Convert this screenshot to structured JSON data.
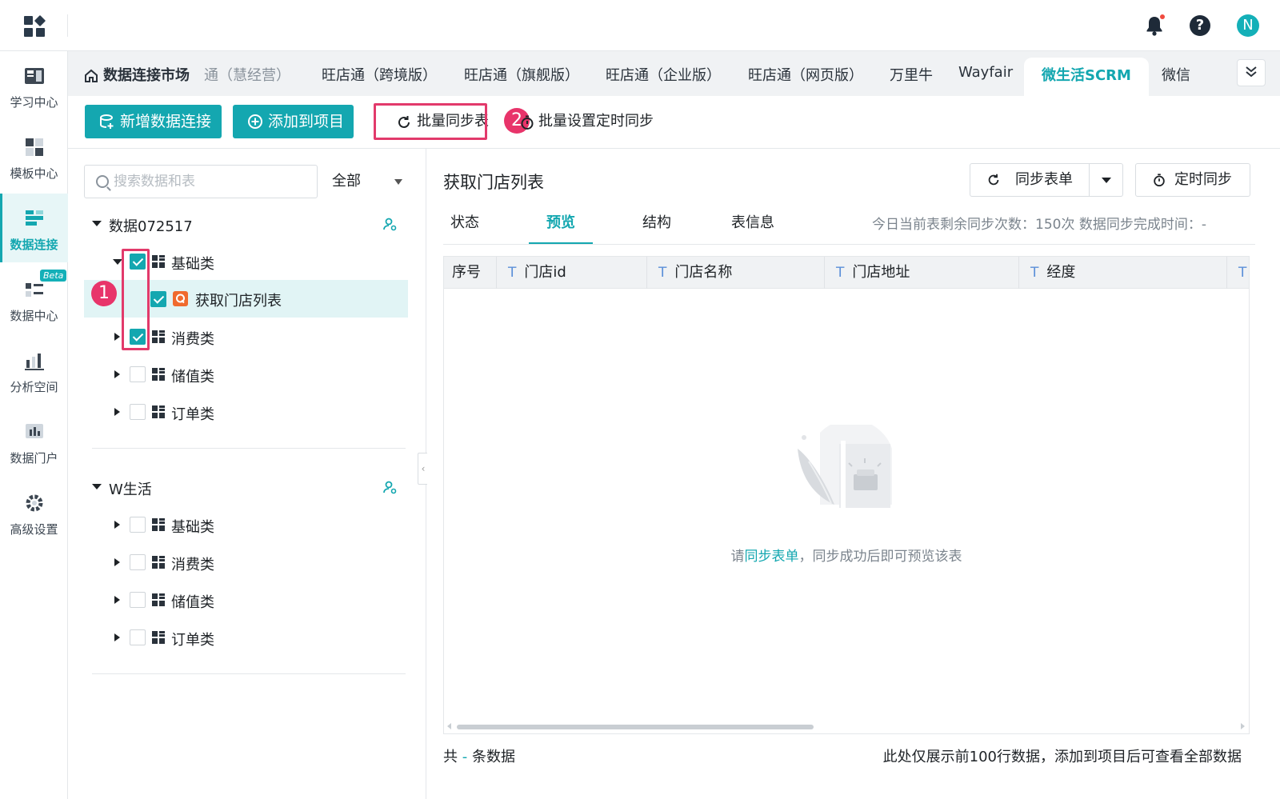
{
  "header": {
    "notification_dot": true,
    "help": "?",
    "avatar": "N"
  },
  "leftnav": {
    "items": [
      {
        "label": "学习中心",
        "icon": "book-icon"
      },
      {
        "label": "模板中心",
        "icon": "template-icon"
      },
      {
        "label": "数据连接",
        "icon": "data-connect-icon",
        "active": true
      },
      {
        "label": "数据中心",
        "icon": "data-center-icon",
        "badge": "Beta"
      },
      {
        "label": "分析空间",
        "icon": "analysis-icon"
      },
      {
        "label": "数据门户",
        "icon": "portal-icon"
      },
      {
        "label": "高级设置",
        "icon": "gear-icon"
      }
    ]
  },
  "tabs": {
    "home": "数据连接市场",
    "items": [
      "通（慧经营）",
      "旺店通（跨境版）",
      "旺店通（旗舰版）",
      "旺店通（企业版）",
      "旺店通（网页版）",
      "万里牛",
      "Wayfair",
      "微生活SCRM",
      "微信"
    ],
    "active": "微生活SCRM"
  },
  "toolbar": {
    "new_connection": "新增数据连接",
    "add_to_project": "添加到项目",
    "batch_sync": "批量同步表",
    "batch_timed_sync": "批量设置定时同步",
    "badge1": "1",
    "badge2": "2"
  },
  "tree": {
    "search_placeholder": "搜索数据和表",
    "scope": "全部",
    "groups": [
      {
        "name": "数据072517",
        "children": [
          {
            "label": "基础类",
            "checked": true,
            "expanded": true
          },
          {
            "label": "获取门店列表",
            "checked": true,
            "leaf": true,
            "selected": true
          },
          {
            "label": "消费类",
            "checked": true
          },
          {
            "label": "储值类",
            "checked": false
          },
          {
            "label": "订单类",
            "checked": false
          }
        ]
      },
      {
        "name": "W生活",
        "children": [
          {
            "label": "基础类",
            "checked": false
          },
          {
            "label": "消费类",
            "checked": false
          },
          {
            "label": "储值类",
            "checked": false
          },
          {
            "label": "订单类",
            "checked": false
          }
        ]
      }
    ]
  },
  "detail": {
    "title": "获取门店列表",
    "sync_button": "同步表单",
    "timed_sync_button": "定时同步",
    "tabs": [
      "状态",
      "预览",
      "结构",
      "表信息"
    ],
    "active_tab": "预览",
    "sync_info": "今日当前表剩余同步次数：150次   数据同步完成时间：-",
    "columns": [
      "序号",
      "门店id",
      "门店名称",
      "门店地址",
      "经度",
      ""
    ],
    "column_type": "T",
    "empty_prefix": "请",
    "empty_link": "同步表单",
    "empty_suffix": "，同步成功后即可预览该表",
    "footer_prefix": "共",
    "footer_count": "-",
    "footer_suffix": "条数据",
    "footer_note": "此处仅展示前100行数据，添加到项目后可查看全部数据"
  },
  "colors": {
    "accent": "#14a7b0",
    "highlight": "#e23a6b"
  }
}
